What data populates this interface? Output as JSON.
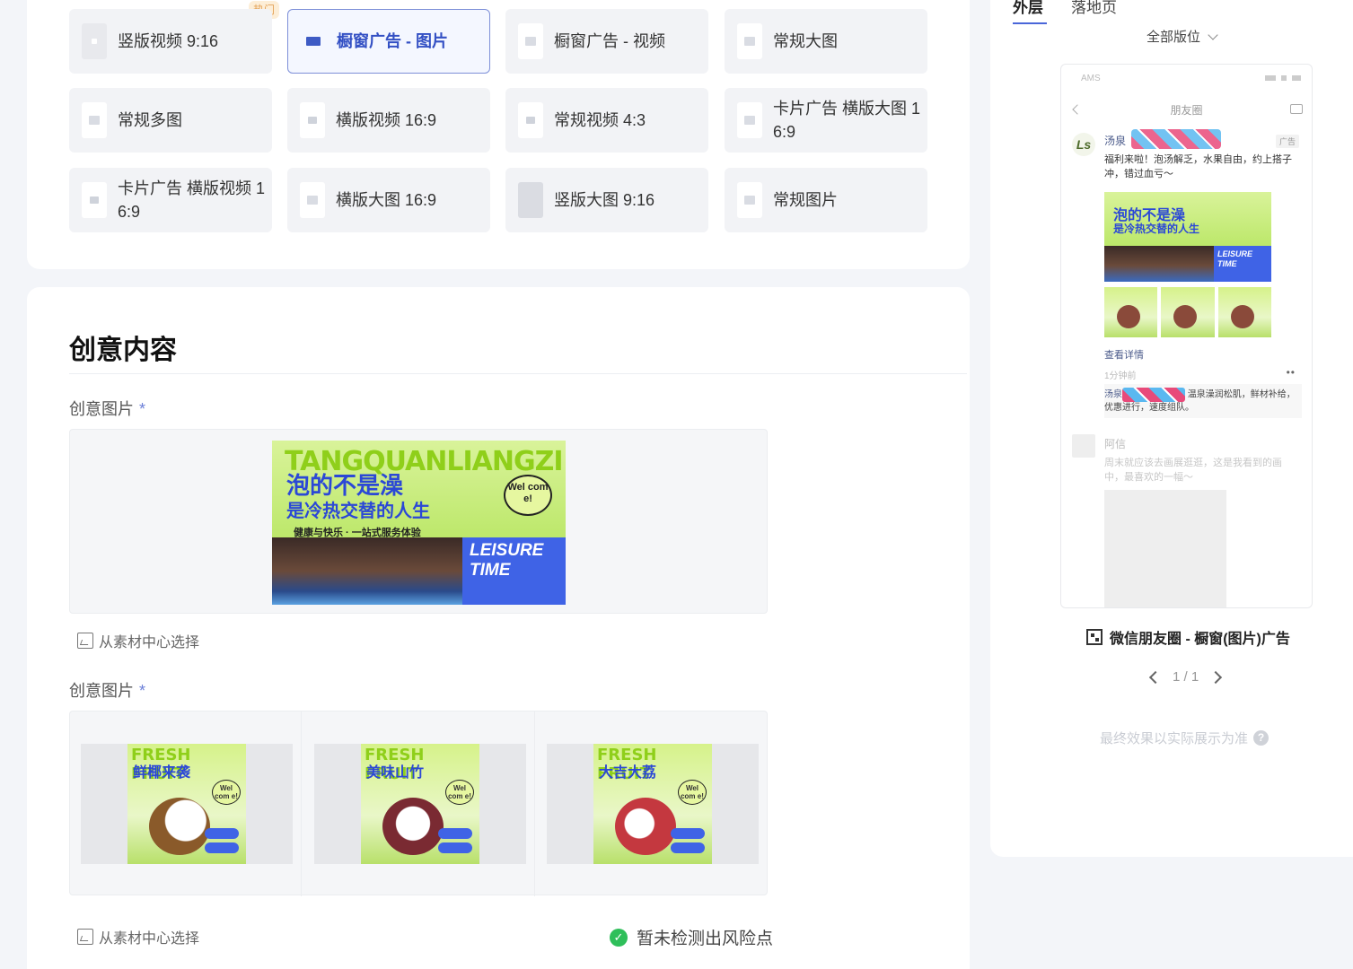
{
  "format_tiles": [
    {
      "label": "竖版视频 9:16"
    },
    {
      "label": "橱窗广告 - 图片"
    },
    {
      "label": "橱窗广告 - 视频"
    },
    {
      "label": "常规大图"
    },
    {
      "label": "常规多图"
    },
    {
      "label": "横版视频 16:9"
    },
    {
      "label": "常规视频  4:3"
    },
    {
      "label": "卡片广告 横版大图 1\n6:9"
    },
    {
      "label": "卡片广告 横版视频 1\n6:9"
    },
    {
      "label": "横版大图 16:9"
    },
    {
      "label": "竖版大图 9:16"
    },
    {
      "label": "常规图片"
    }
  ],
  "hot_badge": "热门",
  "creative": {
    "title": "创意内容",
    "field1_label": "创意图片",
    "field2_label": "创意图片",
    "required_mark": "*",
    "material_link": "从素材中心选择",
    "risk_status": "暂未检测出风险点",
    "banner": {
      "top_text": "TANGQUANLIANGZI",
      "headline": "泡的不是澡",
      "subheadline": "是冷热交替的人生",
      "tagline": "健康与快乐 · 一站式服务体验",
      "leisure": "LEISURE TIME",
      "badge": "Wel com e!"
    },
    "fruits": [
      {
        "top": "FRESH FRUIT",
        "title": "鲜椰来袭",
        "ball_color": "#f2efe6"
      },
      {
        "top": "FRESH FRUIT",
        "title": "美味山竹",
        "ball_color": "#8a3b3b"
      },
      {
        "top": "FRESH FRUIT",
        "title": "大吉大荔",
        "ball_color": "#c4383f"
      }
    ]
  },
  "preview": {
    "tab_outer": "外层",
    "tab_landing": "落地页",
    "placement": "全部版位",
    "phone": {
      "status": "AMS",
      "nav_title": "朋友圈",
      "author": "汤泉",
      "ad_badge": "广告",
      "post_text": "福利来啦！泡汤解乏，水果自由，约上搭子冲，错过血亏～",
      "detail": "查看详情",
      "time": "1分钟前",
      "comment_name": "汤泉",
      "comment_text": "温泉澡润松肌，鲜材补给，优惠进行，速度组队。",
      "fade_name": "阿信",
      "fade_text": "周末就应该去画展逛逛，这是我看到的画中，最喜欢的一幅～",
      "mini_h1": "泡的不是澡",
      "mini_h2": "是冷热交替的人生",
      "mini_leisure": "LEISURE TIME"
    },
    "caption": "微信朋友圈 - 橱窗(图片)广告",
    "pager": "1 / 1",
    "disclaimer": "最终效果以实际展示为准"
  }
}
